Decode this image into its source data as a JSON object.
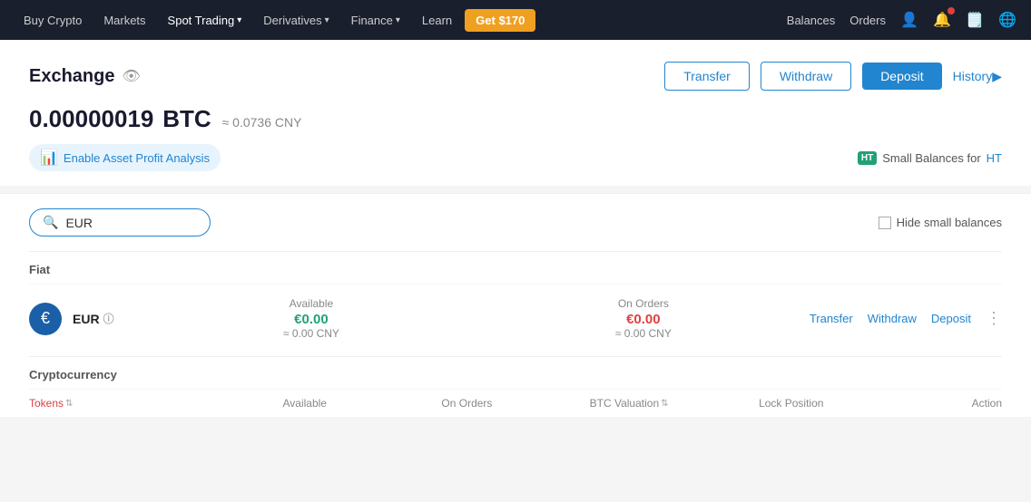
{
  "navbar": {
    "items": [
      {
        "id": "buy-crypto",
        "label": "Buy Crypto",
        "hasDropdown": false
      },
      {
        "id": "markets",
        "label": "Markets",
        "hasDropdown": false
      },
      {
        "id": "spot-trading",
        "label": "Spot Trading",
        "hasDropdown": true
      },
      {
        "id": "derivatives",
        "label": "Derivatives",
        "hasDropdown": true
      },
      {
        "id": "finance",
        "label": "Finance",
        "hasDropdown": true
      },
      {
        "id": "learn",
        "label": "Learn",
        "hasDropdown": false
      }
    ],
    "get_btn": "Get $170",
    "right": {
      "balances": "Balances",
      "orders": "Orders"
    }
  },
  "exchange": {
    "title": "Exchange",
    "balance": {
      "amount": "0.00000019",
      "unit": "BTC",
      "approx": "≈ 0.0736 CNY"
    },
    "enable_profit": "Enable Asset Profit Analysis",
    "ht_badge": "HT",
    "ht_text": "Small Balances for",
    "ht_link": "HT"
  },
  "buttons": {
    "transfer": "Transfer",
    "withdraw": "Withdraw",
    "deposit": "Deposit",
    "history": "History"
  },
  "filter": {
    "search_value": "EUR",
    "search_placeholder": "Search",
    "hide_label": "Hide small balances"
  },
  "fiat": {
    "section_label": "Fiat",
    "rows": [
      {
        "icon": "€",
        "name": "EUR",
        "available_label": "Available",
        "available_value": "€0.00",
        "available_sub": "≈ 0.00 CNY",
        "orders_label": "On Orders",
        "orders_value": "€0.00",
        "orders_sub": "≈ 0.00 CNY",
        "actions": [
          "Transfer",
          "Withdraw",
          "Deposit"
        ]
      }
    ]
  },
  "crypto": {
    "section_label": "Cryptocurrency",
    "columns": {
      "tokens": "Tokens",
      "available": "Available",
      "on_orders": "On Orders",
      "btc_valuation": "BTC Valuation",
      "lock_position": "Lock Position",
      "action": "Action"
    }
  }
}
